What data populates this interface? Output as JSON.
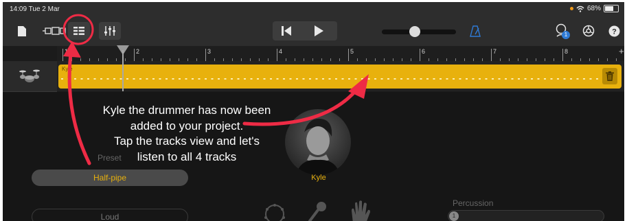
{
  "status": {
    "time": "14:09",
    "date": "Tue 2 Mar",
    "battery": "68%",
    "battery_level": 0.68
  },
  "ruler": {
    "bars": [
      "1",
      "2",
      "3",
      "4",
      "5",
      "6",
      "7",
      "8"
    ]
  },
  "track": {
    "region_name": "Kyle"
  },
  "caption": {
    "line1": "Kyle the drummer has now been",
    "line2": "added to your project.",
    "line3": "Tap the tracks view and let's",
    "line4": "listen to all 4 tracks"
  },
  "editor": {
    "preset_label": "Preset",
    "preset_value": "Half-pipe",
    "loud_label": "Loud",
    "drummer_name": "Kyle",
    "percussion_label": "Percussion",
    "percussion_value": "1"
  },
  "badges": {
    "notification_count": "1"
  },
  "colors": {
    "accent": "#e8b10d",
    "annotation": "#ee2b45",
    "metronome": "#2f7bd6"
  },
  "icons": [
    "document-icon",
    "track-view-icon",
    "tracks-list-icon",
    "mixer-icon",
    "skip-back-icon",
    "play-icon",
    "metronome-icon",
    "loop-browser-icon",
    "settings-icon",
    "help-icon",
    "trash-icon",
    "drums-icon",
    "tambourine-icon",
    "microphone-icon",
    "hand-clap-icon"
  ]
}
